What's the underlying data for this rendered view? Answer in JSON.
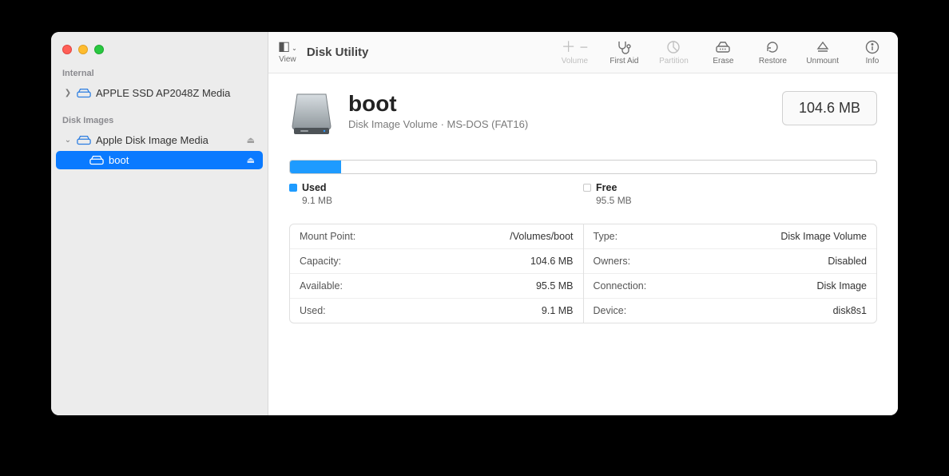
{
  "app_title": "Disk Utility",
  "toolbar": {
    "view_label": "View",
    "volume_label": "Volume",
    "first_aid_label": "First Aid",
    "partition_label": "Partition",
    "erase_label": "Erase",
    "restore_label": "Restore",
    "unmount_label": "Unmount",
    "info_label": "Info"
  },
  "sidebar": {
    "section_internal": "Internal",
    "section_images": "Disk Images",
    "internal_item": "APPLE SSD AP2048Z Media",
    "image_parent": "Apple Disk Image Media",
    "image_child": "boot"
  },
  "volume": {
    "name": "boot",
    "subtitle": "Disk Image Volume · MS-DOS (FAT16)",
    "size": "104.6 MB"
  },
  "usage": {
    "used_label": "Used",
    "used_value": "9.1 MB",
    "free_label": "Free",
    "free_value": "95.5 MB",
    "used_percent": 8.7
  },
  "details": {
    "left": [
      {
        "k": "Mount Point:",
        "v": "/Volumes/boot"
      },
      {
        "k": "Capacity:",
        "v": "104.6 MB"
      },
      {
        "k": "Available:",
        "v": "95.5 MB"
      },
      {
        "k": "Used:",
        "v": "9.1 MB"
      }
    ],
    "right": [
      {
        "k": "Type:",
        "v": "Disk Image Volume"
      },
      {
        "k": "Owners:",
        "v": "Disabled"
      },
      {
        "k": "Connection:",
        "v": "Disk Image"
      },
      {
        "k": "Device:",
        "v": "disk8s1"
      }
    ]
  }
}
